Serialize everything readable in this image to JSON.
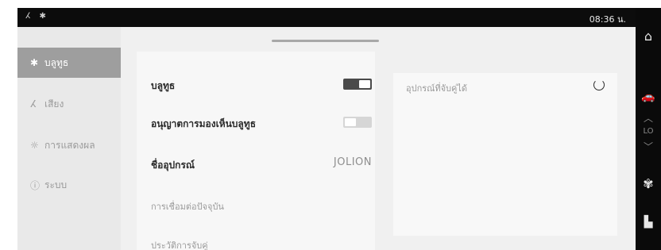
{
  "status_bar": {
    "icons_text": "ⵃ ✱",
    "time": "08:36 น."
  },
  "rail": {
    "home_icon": "⌂",
    "car_icon": "🚗",
    "up_icon": "︿",
    "lo_label": "LO",
    "down_icon": "﹀",
    "fan_icon": "✾",
    "seat_icon": "▙"
  },
  "sidebar": {
    "items": [
      {
        "icon": "✱",
        "label": "บลูทูธ",
        "active": true
      },
      {
        "icon": "ⵃ",
        "label": "เสียง",
        "active": false
      },
      {
        "icon": "☼",
        "label": "การแสดงผล",
        "active": false
      },
      {
        "icon": "ⓘ",
        "label": "ระบบ",
        "active": false
      }
    ]
  },
  "settings": {
    "bluetooth_label": "บลูทูธ",
    "bluetooth_on": true,
    "visibility_label": "อนุญาตการมองเห็นบลูทูธ",
    "visibility_on": false,
    "device_name_label": "ชื่ออุปกรณ์",
    "device_name_value": "JOLION",
    "current_connection_label": "การเชื่อมต่อปัจจุบัน",
    "pairing_history_label": "ประวัติการจับคู่"
  },
  "devices": {
    "label": "อุปกรณ์ที่จับคู่ได้"
  }
}
